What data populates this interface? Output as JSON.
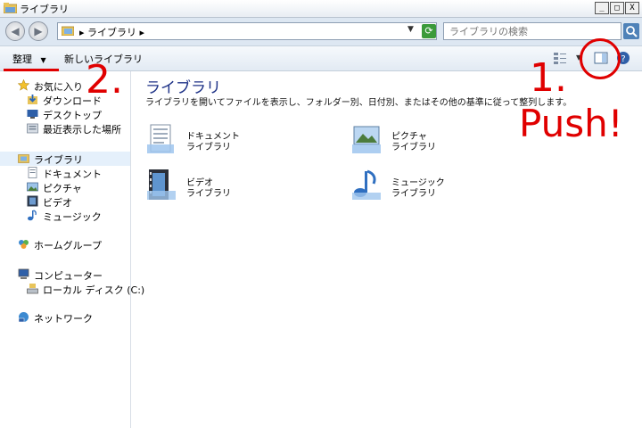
{
  "window": {
    "title": "ライブラリ",
    "controls": [
      "_",
      "□",
      "X"
    ]
  },
  "address": {
    "crumb": "▸ ライブラリ ▸",
    "search_placeholder": "ライブラリの検索"
  },
  "toolbar": {
    "organize_label": "整理",
    "organize_arrow": "▼",
    "new_library_label": "新しいライブラリ"
  },
  "sidebar": {
    "favorites": {
      "label": "お気に入り",
      "items": [
        "ダウンロード",
        "デスクトップ",
        "最近表示した場所"
      ]
    },
    "libraries": {
      "label": "ライブラリ",
      "items": [
        "ドキュメント",
        "ピクチャ",
        "ビデオ",
        "ミュージック"
      ]
    },
    "homegroup": "ホームグループ",
    "computer": {
      "label": "コンピューター",
      "items": [
        "ローカル ディスク (C:)"
      ]
    },
    "network": "ネットワーク"
  },
  "main": {
    "heading": "ライブラリ",
    "description": "ライブラリを開いてファイルを表示し、フォルダー別、日付別、またはその他の基準に従って整列します。",
    "libraries": [
      {
        "name": "ドキュメント",
        "type": "ライブラリ",
        "icon": "documents-icon"
      },
      {
        "name": "ピクチャ",
        "type": "ライブラリ",
        "icon": "pictures-icon"
      },
      {
        "name": "ビデオ",
        "type": "ライブラリ",
        "icon": "videos-icon"
      },
      {
        "name": "ミュージック",
        "type": "ライブラリ",
        "icon": "music-icon"
      }
    ]
  },
  "annotations": {
    "step1": "1.",
    "step2": "2.",
    "push": "Push!",
    "color": "#e00000"
  }
}
